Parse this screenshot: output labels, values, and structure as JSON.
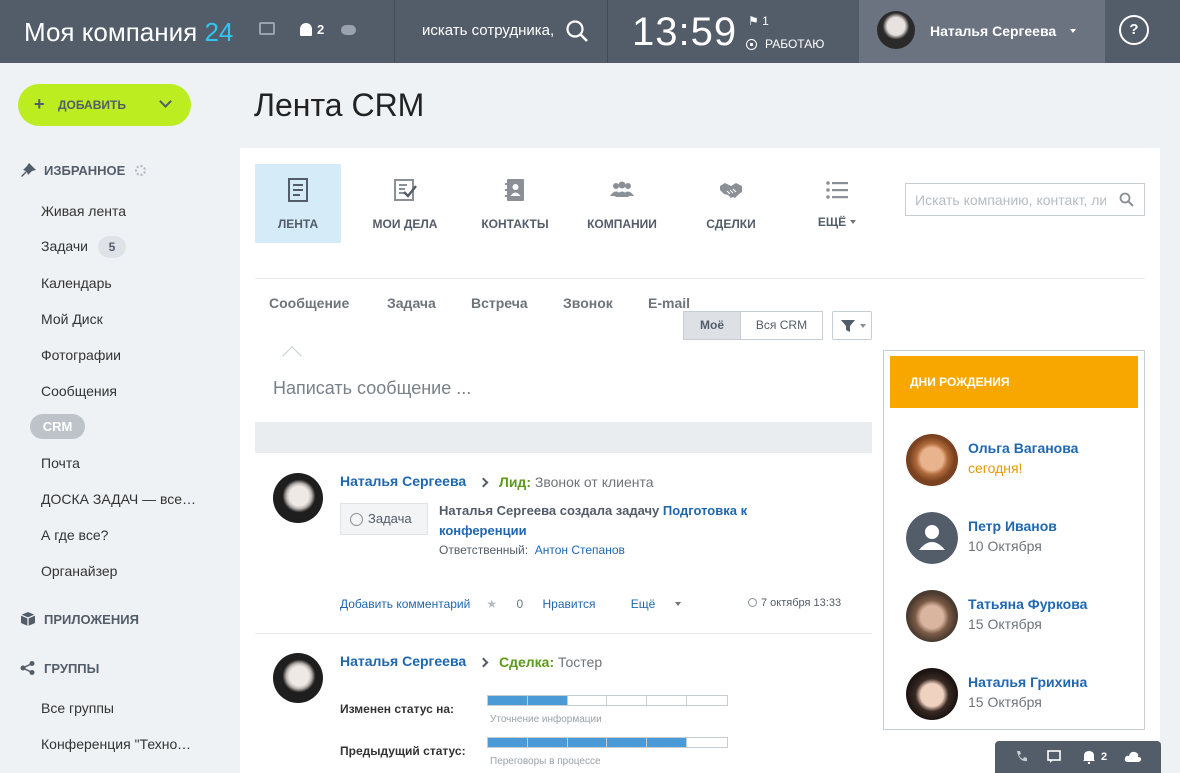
{
  "topbar": {
    "logo_text": "Моя компания",
    "logo_num": "24",
    "notif_count": "2",
    "search_text": "искать сотрудника,",
    "time": "13:59",
    "flag_count": "1",
    "work_status": "РАБОТАЮ",
    "user_name": "Наталья Сергеева",
    "help": "?"
  },
  "sidebar": {
    "add_label": "ДОБАВИТЬ",
    "favorites_title": "ИЗБРАННОЕ",
    "items": [
      {
        "label": "Живая лента"
      },
      {
        "label": "Задачи",
        "badge": "5"
      },
      {
        "label": "Календарь"
      },
      {
        "label": "Мой Диск"
      },
      {
        "label": "Фотографии"
      },
      {
        "label": "Сообщения"
      },
      {
        "label": "CRM"
      },
      {
        "label": "Почта"
      },
      {
        "label": "ДОСКА ЗАДАЧ — все задачи компании"
      },
      {
        "label": "А где все?"
      },
      {
        "label": "Органайзер"
      }
    ],
    "apps_title": "ПРИЛОЖЕНИЯ",
    "groups_title": "ГРУППЫ",
    "group_items": [
      {
        "label": "Все группы"
      },
      {
        "label": "Конференция \"Технологии\""
      }
    ]
  },
  "main": {
    "title": "Лента CRM",
    "tabs": [
      {
        "label": "ЛЕНТА",
        "icon": "feed-icon"
      },
      {
        "label": "МОИ ДЕЛА",
        "icon": "checklist-icon"
      },
      {
        "label": "КОНТАКТЫ",
        "icon": "contacts-icon"
      },
      {
        "label": "КОМПАНИИ",
        "icon": "companies-icon"
      },
      {
        "label": "СДЕЛКИ",
        "icon": "handshake-icon"
      },
      {
        "label": "ЕЩЁ",
        "icon": "list-icon"
      }
    ],
    "search_placeholder": "Искать компанию, контакт, лид",
    "post_tabs": [
      "Сообщение",
      "Задача",
      "Встреча",
      "Звонок",
      "E-mail"
    ],
    "scope": {
      "mine": "Моё",
      "all": "Вся CRM"
    },
    "compose_placeholder": "Написать сообщение ...",
    "posts": [
      {
        "author": "Наталья Сергеева",
        "entity_type": "Лид:",
        "entity_name": "Звонок от клиента",
        "badge": "Задача",
        "text": "Наталья Сергеева создала задачу",
        "task_link": "Подготовка к конференции",
        "resp_label": "Ответственный:",
        "resp_name": "Антон Степанов",
        "add_comment": "Добавить комментарий",
        "likes": "0",
        "like_label": "Нравится",
        "more": "Ещё",
        "date": "7 октября 13:33"
      },
      {
        "author": "Наталья Сергеева",
        "entity_type": "Сделка:",
        "entity_name": "Тостер",
        "new_status_label": "Изменен статус на:",
        "new_status": "Уточнение информации",
        "new_status_progress": 0.4,
        "prev_status_label": "Предыдущий статус:",
        "prev_status": "Переговоры в процессе",
        "prev_status_progress": 0.8
      }
    ]
  },
  "birthdays": {
    "title": "ДНИ РОЖДЕНИЯ",
    "people": [
      {
        "name": "Ольга Ваганова",
        "date": "сегодня!"
      },
      {
        "name": "Петр Иванов",
        "date": "10 Октября"
      },
      {
        "name": "Татьяна Фуркова",
        "date": "15 Октября"
      },
      {
        "name": "Наталья Грихина",
        "date": "15 Октября"
      }
    ]
  },
  "bottom": {
    "notif_count": "2"
  },
  "colors": {
    "accent": "#bbed21",
    "topbar": "#535c69",
    "link": "#2067b0",
    "birthday": "#f7a700"
  }
}
